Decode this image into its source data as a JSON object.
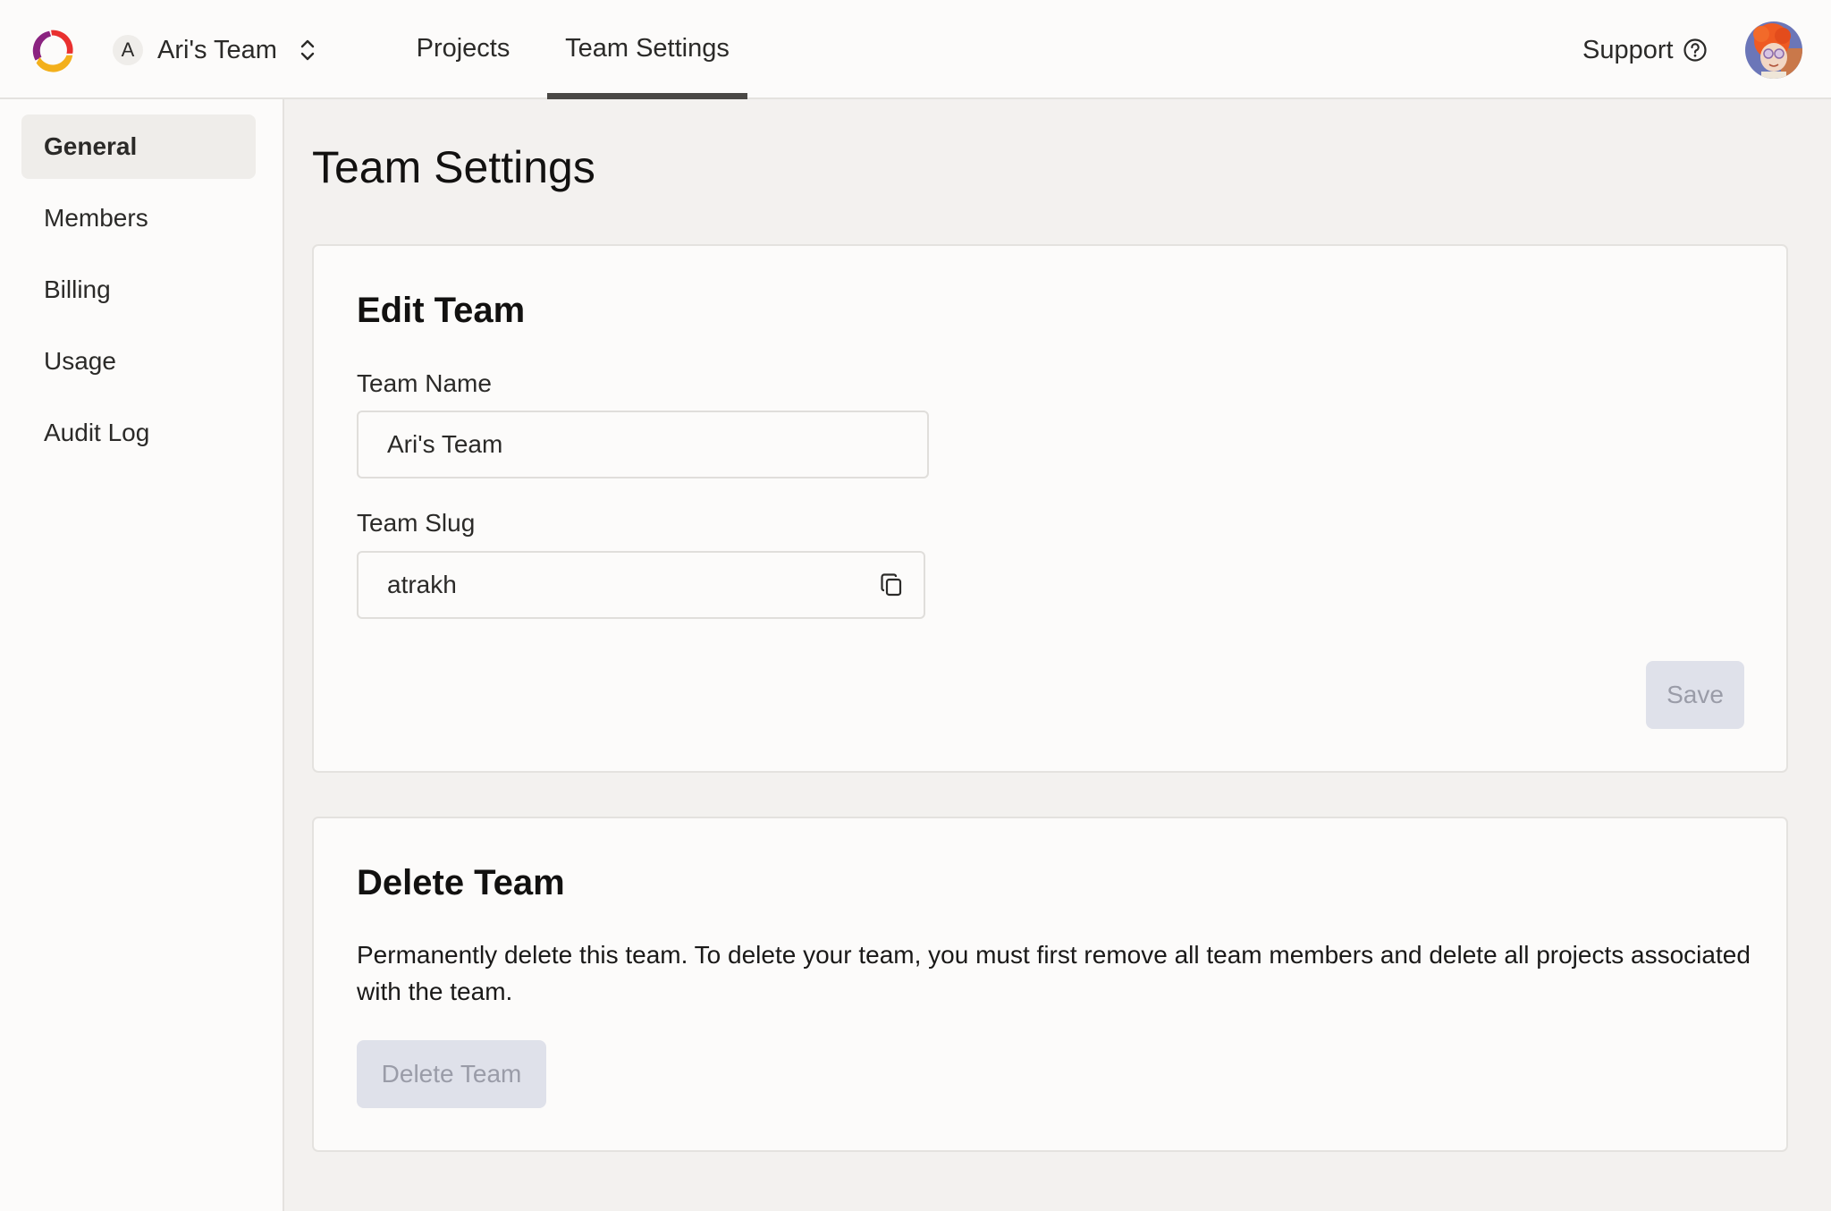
{
  "header": {
    "logo": "app-logo",
    "team_switcher": {
      "avatar_initial": "A",
      "team_name": "Ari's Team",
      "icon": "chevron-up-down-icon"
    },
    "tabs": [
      {
        "label": "Projects",
        "active": false
      },
      {
        "label": "Team Settings",
        "active": true
      }
    ],
    "support_label": "Support",
    "support_icon": "question-circle-icon",
    "user_avatar": "user-avatar"
  },
  "sidebar": {
    "items": [
      {
        "label": "General",
        "active": true
      },
      {
        "label": "Members",
        "active": false
      },
      {
        "label": "Billing",
        "active": false
      },
      {
        "label": "Usage",
        "active": false
      },
      {
        "label": "Audit Log",
        "active": false
      }
    ]
  },
  "main": {
    "title": "Team Settings",
    "edit_team": {
      "title": "Edit Team",
      "team_name_label": "Team Name",
      "team_name_value": "Ari's Team",
      "team_slug_label": "Team Slug",
      "team_slug_value": "atrakh",
      "copy_icon": "copy-icon",
      "save_label": "Save",
      "save_disabled": true
    },
    "delete_team": {
      "title": "Delete Team",
      "description": "Permanently delete this team. To delete your team, you must first remove all team members and delete all projects associated with the team.",
      "button_label": "Delete Team",
      "button_disabled": true
    }
  },
  "colors": {
    "logo_purple": "#8b2380",
    "logo_red": "#e9302f",
    "logo_yellow": "#f3b01c",
    "disabled_button_bg": "#dfe1ea",
    "disabled_button_text": "#9a9ca8",
    "active_tab_underline": "#4a4845"
  }
}
